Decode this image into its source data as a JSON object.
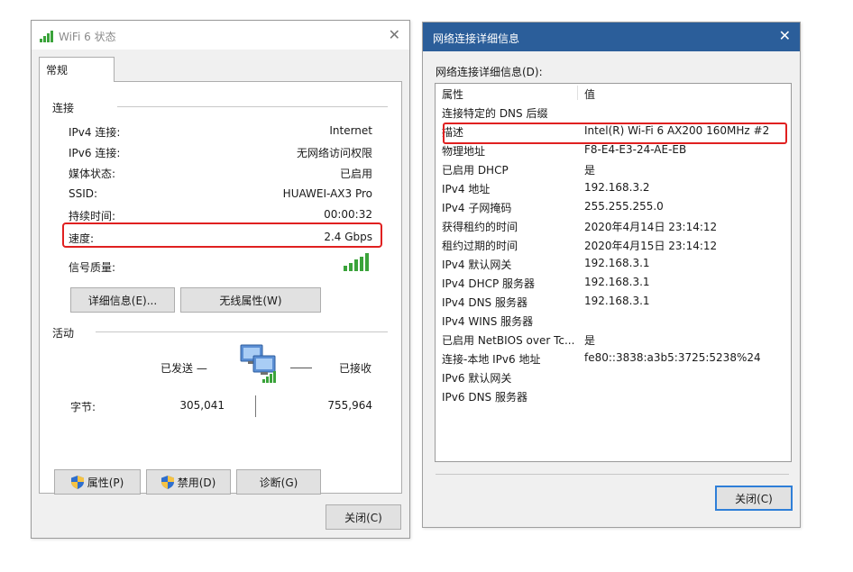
{
  "left_window": {
    "title": "WiFi 6 状态",
    "tab": "常规",
    "connection_group": "连接",
    "rows": [
      {
        "label": "IPv4 连接:",
        "value": "Internet"
      },
      {
        "label": "IPv6 连接:",
        "value": "无网络访问权限"
      },
      {
        "label": "媒体状态:",
        "value": "已启用"
      },
      {
        "label": "SSID:",
        "value": "HUAWEI-AX3 Pro"
      },
      {
        "label": "持续时间:",
        "value": "00:00:32"
      },
      {
        "label": "速度:",
        "value": "2.4 Gbps"
      }
    ],
    "signal_label": "信号质量:",
    "details_button": "详细信息(E)...",
    "wireless_button": "无线属性(W)",
    "activity_group": "活动",
    "sent_label": "已发送 —",
    "recv_label": "已接收",
    "bytes_label": "字节:",
    "bytes_sent": "305,041",
    "bytes_received": "755,964",
    "properties_button": "属性(P)",
    "disable_button": "禁用(D)",
    "diagnose_button": "诊断(G)",
    "close_button": "关闭(C)"
  },
  "right_window": {
    "title": "网络连接详细信息",
    "details_label": "网络连接详细信息(D):",
    "columns": [
      "属性",
      "值"
    ],
    "rows": [
      {
        "prop": "连接特定的 DNS 后缀",
        "value": ""
      },
      {
        "prop": "描述",
        "value": "Intel(R) Wi-Fi 6 AX200 160MHz #2"
      },
      {
        "prop": "物理地址",
        "value": "F8-E4-E3-24-AE-EB"
      },
      {
        "prop": "已启用 DHCP",
        "value": "是"
      },
      {
        "prop": "IPv4 地址",
        "value": "192.168.3.2"
      },
      {
        "prop": "IPv4 子网掩码",
        "value": "255.255.255.0"
      },
      {
        "prop": "获得租约的时间",
        "value": "2020年4月14日 23:14:12"
      },
      {
        "prop": "租约过期的时间",
        "value": "2020年4月15日 23:14:12"
      },
      {
        "prop": "IPv4 默认网关",
        "value": "192.168.3.1"
      },
      {
        "prop": "IPv4 DHCP 服务器",
        "value": "192.168.3.1"
      },
      {
        "prop": "IPv4 DNS 服务器",
        "value": "192.168.3.1"
      },
      {
        "prop": "IPv4 WINS 服务器",
        "value": ""
      },
      {
        "prop": "已启用 NetBIOS over Tc...",
        "value": "是"
      },
      {
        "prop": "连接-本地 IPv6 地址",
        "value": "fe80::3838:a3b5:3725:5238%24"
      },
      {
        "prop": "IPv6 默认网关",
        "value": ""
      },
      {
        "prop": "IPv6 DNS 服务器",
        "value": ""
      }
    ],
    "close_button": "关闭(C)"
  },
  "colors": {
    "titlebar_active": "#2b5e9a",
    "highlight": "#e02020",
    "signal_green": "#3aa33a",
    "button_focus": "#2f7fd8"
  },
  "icons": [
    "wifi-signal-icon",
    "close-icon",
    "network-computers-icon",
    "uac-shield-icon"
  ]
}
